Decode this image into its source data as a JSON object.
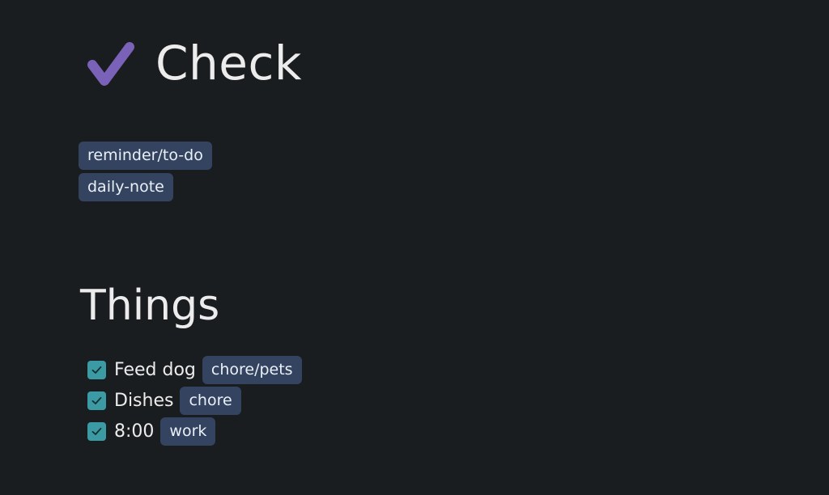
{
  "note": {
    "title": "Check",
    "title_icon": "heavy-check-mark-icon",
    "accent_color": "#7a62b8",
    "tags": [
      "reminder/to-do",
      "daily-note"
    ]
  },
  "section": {
    "heading": "Things",
    "tasks": [
      {
        "text": "Feed dog",
        "tag": "chore/pets",
        "checked": true
      },
      {
        "text": "Dishes",
        "tag": "chore",
        "checked": true
      },
      {
        "text": "8:00",
        "tag": "work",
        "checked": true
      }
    ]
  },
  "colors": {
    "background": "#1a1d1f",
    "tag_background": "#34435f",
    "checkbox": "#3b9aa4"
  }
}
